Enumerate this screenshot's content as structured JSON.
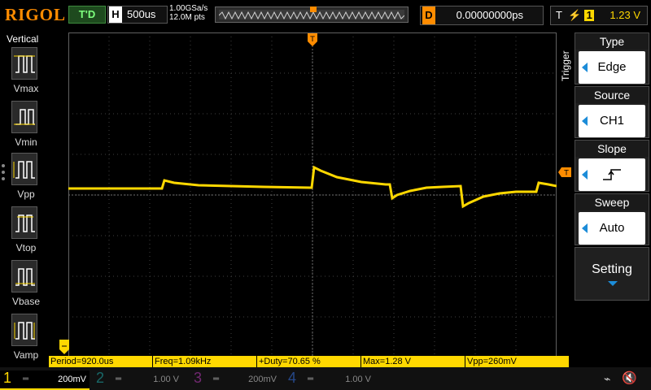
{
  "brand": "RIGOL",
  "run_status": "T'D",
  "timebase": {
    "key": "H",
    "value": "500us"
  },
  "sampling": {
    "rate": "1.00GSa/s",
    "points": "12.0M pts"
  },
  "delay": {
    "key": "D",
    "value": "0.00000000ps"
  },
  "trigger_status": {
    "key": "T",
    "source": "1",
    "level": "1.23 V"
  },
  "left_panel": {
    "title": "Vertical",
    "items": [
      {
        "label": "Vmax",
        "icon": "vmax-icon"
      },
      {
        "label": "Vmin",
        "icon": "vmin-icon"
      },
      {
        "label": "Vpp",
        "icon": "vpp-icon"
      },
      {
        "label": "Vtop",
        "icon": "vtop-icon"
      },
      {
        "label": "Vbase",
        "icon": "vbase-icon"
      },
      {
        "label": "Vamp",
        "icon": "vamp-icon"
      }
    ]
  },
  "menu": {
    "title": "Trigger",
    "items": [
      {
        "title": "Type",
        "value": "Edge"
      },
      {
        "title": "Source",
        "value": "CH1"
      },
      {
        "title": "Slope",
        "value": ""
      },
      {
        "title": "Sweep",
        "value": "Auto"
      },
      {
        "title": "Setting",
        "value": ""
      }
    ]
  },
  "measurements": [
    "Period=920.0us",
    "Freq=1.09kHz",
    "+Duty=70.65 %",
    "Max=1.28 V",
    "Vpp=260mV"
  ],
  "channels": [
    {
      "num": "1",
      "scale": "200mV",
      "color": "#ffd800",
      "active": true
    },
    {
      "num": "2",
      "scale": "1.00 V",
      "color": "#1fbfbf",
      "active": false
    },
    {
      "num": "3",
      "scale": "200mV",
      "color": "#d040d0",
      "active": false
    },
    {
      "num": "4",
      "scale": "1.00 V",
      "color": "#3a7dff",
      "active": false
    }
  ],
  "colors": {
    "trace": "#ffd800",
    "marker": "#ff8c00",
    "grid": "#404040"
  }
}
